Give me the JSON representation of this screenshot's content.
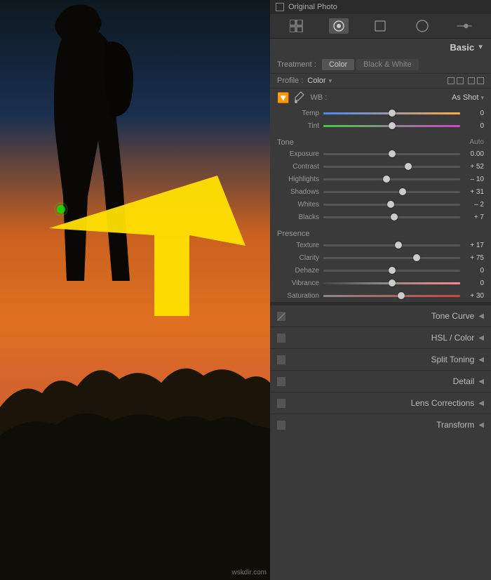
{
  "photo": {
    "watermark": "wskdir.com"
  },
  "topbar": {
    "original_photo_label": "Original Photo"
  },
  "toolbar": {
    "icons": [
      "grid",
      "circle-dot",
      "radio",
      "square",
      "circle",
      "slider"
    ]
  },
  "basic": {
    "title": "Basic",
    "treatment_label": "Treatment :",
    "color_btn": "Color",
    "bw_btn": "Black & White",
    "profile_label": "Profile :",
    "profile_value": "Color",
    "wb_label": "WB :",
    "wb_value": "As Shot",
    "tone_label": "Tone",
    "tone_auto": "Auto",
    "presence_label": "Presence",
    "sliders": {
      "temp": {
        "label": "Temp",
        "value": "0",
        "position": 50
      },
      "tint": {
        "label": "Tint",
        "value": "0",
        "position": 50
      },
      "exposure": {
        "label": "Exposure",
        "value": "0.00",
        "position": 50
      },
      "contrast": {
        "label": "Contrast",
        "value": "+ 52",
        "position": 62
      },
      "highlights": {
        "label": "Highlights",
        "value": "– 10",
        "position": 46
      },
      "shadows": {
        "label": "Shadows",
        "value": "+ 31",
        "position": 58
      },
      "whites": {
        "label": "Whites",
        "value": "– 2",
        "position": 49
      },
      "blacks": {
        "label": "Blacks",
        "value": "+ 7",
        "position": 52
      },
      "texture": {
        "label": "Texture",
        "value": "+ 17",
        "position": 55
      },
      "clarity": {
        "label": "Clarity",
        "value": "+ 75",
        "position": 68
      },
      "dehaze": {
        "label": "Dehaze",
        "value": "0",
        "position": 50
      },
      "vibrance": {
        "label": "Vibrance",
        "value": "0",
        "position": 50
      },
      "saturation": {
        "label": "Saturation",
        "value": "+ 30",
        "position": 57
      }
    }
  },
  "collapsed_sections": [
    {
      "id": "tone-curve",
      "title": "Tone Curve"
    },
    {
      "id": "hsl-color",
      "title": "HSL / Color"
    },
    {
      "id": "split-toning",
      "title": "Split Toning"
    },
    {
      "id": "detail",
      "title": "Detail"
    },
    {
      "id": "lens-corrections",
      "title": "Lens Corrections"
    },
    {
      "id": "transform",
      "title": "Transform"
    }
  ]
}
